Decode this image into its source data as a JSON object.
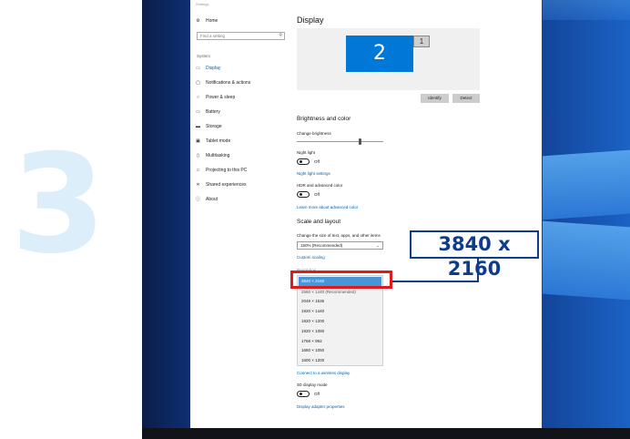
{
  "step_number": "3",
  "window": {
    "title": "Settings"
  },
  "sidebar": {
    "home": {
      "label": "Home",
      "icon": "gear-icon"
    },
    "search_placeholder": "Find a setting",
    "section": "System",
    "items": [
      {
        "label": "Display",
        "icon": "monitor-icon",
        "active": true
      },
      {
        "label": "Notifications & actions",
        "icon": "notifications-icon"
      },
      {
        "label": "Power & sleep",
        "icon": "power-icon"
      },
      {
        "label": "Battery",
        "icon": "battery-icon"
      },
      {
        "label": "Storage",
        "icon": "storage-icon"
      },
      {
        "label": "Tablet mode",
        "icon": "tablet-icon"
      },
      {
        "label": "Multitasking",
        "icon": "multitasking-icon"
      },
      {
        "label": "Projecting to this PC",
        "icon": "projecting-icon"
      },
      {
        "label": "Shared experiences",
        "icon": "shared-icon"
      },
      {
        "label": "About",
        "icon": "info-icon"
      }
    ]
  },
  "main": {
    "title": "Display",
    "monitors": {
      "primary": "2",
      "secondary": "1"
    },
    "identify_label": "Identify",
    "detect_label": "Detect",
    "brightness_heading": "Brightness and color",
    "change_brightness": "Change brightness",
    "brightness_level": 0.72,
    "night_light_label": "Night light",
    "night_light_state": "Off",
    "night_light_settings": "Night light settings",
    "hdr_label": "HDR and advanced color",
    "hdr_state": "Off",
    "hdr_link": "Learn more about advanced color",
    "scale_heading": "Scale and layout",
    "scale_label": "Change the size of text, apps, and other items",
    "scale_value": "150% (Recommended)",
    "custom_scaling": "Custom scaling",
    "resolution_label": "Resolution",
    "resolution_options": [
      "3840 × 2160",
      "2560 × 1440 (Recommended)",
      "2048 × 1536",
      "1920 × 1440",
      "1920 × 1200",
      "1920 × 1080",
      "1768 × 992",
      "1680 × 1050",
      "1600 × 1200"
    ],
    "wireless_link": "Connect to a wireless display",
    "three_d_label": "3D display mode",
    "three_d_state": "Off",
    "adapter_link": "Display adapter properties"
  },
  "callout": {
    "text": "3840 x 2160"
  },
  "colors": {
    "accent": "#0078d7",
    "highlight": "#e0191c",
    "callout": "#0d3b8e"
  }
}
